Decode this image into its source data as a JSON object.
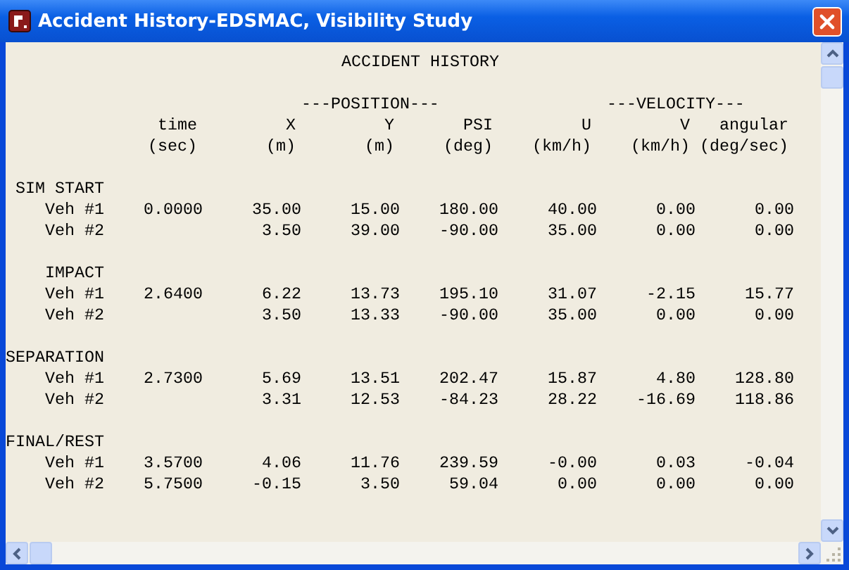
{
  "window": {
    "title": "Accident History-EDSMAC, Visibility Study"
  },
  "report": {
    "title": "ACCIDENT HISTORY",
    "groups": [
      "---POSITION---",
      "---VELOCITY---"
    ],
    "columns": [
      {
        "name": "time",
        "unit": "(sec)"
      },
      {
        "name": "X",
        "unit": "(m)"
      },
      {
        "name": "Y",
        "unit": "(m)"
      },
      {
        "name": "PSI",
        "unit": "(deg)"
      },
      {
        "name": "U",
        "unit": "(km/h)"
      },
      {
        "name": "V",
        "unit": "(km/h)"
      },
      {
        "name": "angular",
        "unit": "(deg/sec)"
      }
    ],
    "sections": [
      {
        "label": "SIM START",
        "rows": [
          {
            "label": "Veh #1",
            "time": "0.0000",
            "values": [
              "35.00",
              "15.00",
              "180.00",
              "40.00",
              "0.00",
              "0.00"
            ]
          },
          {
            "label": "Veh #2",
            "values": [
              "3.50",
              "39.00",
              "-90.00",
              "35.00",
              "0.00",
              "0.00"
            ]
          }
        ]
      },
      {
        "label": "IMPACT",
        "rows": [
          {
            "label": "Veh #1",
            "time": "2.6400",
            "values": [
              "6.22",
              "13.73",
              "195.10",
              "31.07",
              "-2.15",
              "15.77"
            ]
          },
          {
            "label": "Veh #2",
            "values": [
              "3.50",
              "13.33",
              "-90.00",
              "35.00",
              "0.00",
              "0.00"
            ]
          }
        ]
      },
      {
        "label": "SEPARATION",
        "rows": [
          {
            "label": "Veh #1",
            "time": "2.7300",
            "values": [
              "5.69",
              "13.51",
              "202.47",
              "15.87",
              "4.80",
              "128.80"
            ]
          },
          {
            "label": "Veh #2",
            "values": [
              "3.31",
              "12.53",
              "-84.23",
              "28.22",
              "-16.69",
              "118.86"
            ]
          }
        ]
      },
      {
        "label": "FINAL/REST",
        "rows": [
          {
            "label": "Veh #1",
            "time": "3.5700",
            "values": [
              "4.06",
              "11.76",
              "239.59",
              "-0.00",
              "0.03",
              "-0.04"
            ]
          },
          {
            "label": "Veh #2",
            "time": "5.7500",
            "values": [
              "-0.15",
              "3.50",
              "59.04",
              "0.00",
              "0.00",
              "0.00"
            ]
          }
        ]
      }
    ]
  }
}
